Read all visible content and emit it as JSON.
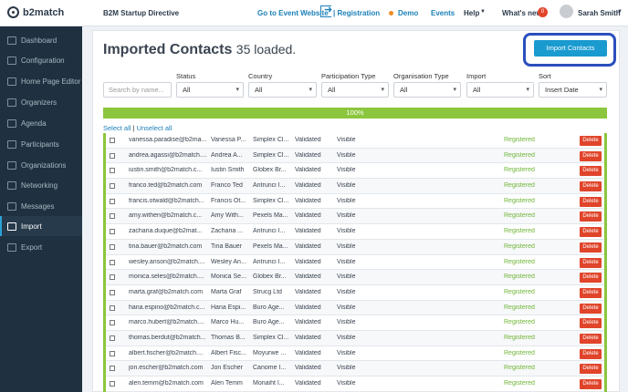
{
  "header": {
    "brand": "b2match",
    "event_name": "B2M Startup Directive",
    "goto_event": "Go to Event Website",
    "registration": "| Registration",
    "demo": "Demo",
    "events": "Events",
    "help": "Help",
    "whats_new": "What's new",
    "notification_count": "0",
    "user_name": "Sarah Smith"
  },
  "sidebar": {
    "items": [
      {
        "label": "Dashboard",
        "icon": "dashboard-icon"
      },
      {
        "label": "Configuration",
        "icon": "wrench-icon"
      },
      {
        "label": "Home Page Editor",
        "icon": "home-icon"
      },
      {
        "label": "Organizers",
        "icon": "people-icon"
      },
      {
        "label": "Agenda",
        "icon": "calendar-icon"
      },
      {
        "label": "Participants",
        "icon": "participant-icon"
      },
      {
        "label": "Organizations",
        "icon": "building-icon"
      },
      {
        "label": "Networking",
        "icon": "network-icon"
      },
      {
        "label": "Messages",
        "icon": "envelope-icon"
      },
      {
        "label": "Import",
        "icon": "import-icon",
        "active": true
      },
      {
        "label": "Export",
        "icon": "export-icon"
      }
    ]
  },
  "page": {
    "title": "Imported Contacts",
    "subtitle": "35 loaded.",
    "import_button": "Import Contacts",
    "search_placeholder": "Search by name...",
    "filters": [
      {
        "label": "Status",
        "value": "All"
      },
      {
        "label": "Country",
        "value": "All"
      },
      {
        "label": "Participation Type",
        "value": "All"
      },
      {
        "label": "Organisation Type",
        "value": "All"
      },
      {
        "label": "Import",
        "value": "All"
      },
      {
        "label": "Sort",
        "value": "Insert Date"
      }
    ],
    "progress_label": "100%",
    "progress_value": 1.0,
    "select_all": "Select all",
    "separator": "|",
    "unselect_all": "Unselect all",
    "delete_label": "Delete"
  },
  "contacts": [
    {
      "email": "vanessa.paradise@b2ma...",
      "name": "Vanessa P...",
      "org": "Simplex Cl...",
      "validated": "Validated",
      "visible": "Visible",
      "status": "Registered"
    },
    {
      "email": "andrea.agassi@b2match....",
      "name": "Andrea A...",
      "org": "Simplex Cl...",
      "validated": "Validated",
      "visible": "Visible",
      "status": "Registered"
    },
    {
      "email": "iustin.smith@b2match.c...",
      "name": "Iustin Smith",
      "org": "Globex Br...",
      "validated": "Validated",
      "visible": "Visible",
      "status": "Registered"
    },
    {
      "email": "franco.ted@b2match.com",
      "name": "Franco Ted",
      "org": "Antrunci I...",
      "validated": "Validated",
      "visible": "Visible",
      "status": "Registered"
    },
    {
      "email": "francis.otwald@b2match...",
      "name": "Francis Ot...",
      "org": "Simplex Cl...",
      "validated": "Validated",
      "visible": "Visible",
      "status": "Registered"
    },
    {
      "email": "amy.withen@b2match.c...",
      "name": "Amy With...",
      "org": "Pexels Ma...",
      "validated": "Validated",
      "visible": "Visible",
      "status": "Registered"
    },
    {
      "email": "zacharia.duque@b2mat...",
      "name": "Zacharia ...",
      "org": "Antrunci I...",
      "validated": "Validated",
      "visible": "Visible",
      "status": "Registered"
    },
    {
      "email": "tina.bauer@b2match.com",
      "name": "Tina Bauer",
      "org": "Pexels Ma...",
      "validated": "Validated",
      "visible": "Visible",
      "status": "Registered"
    },
    {
      "email": "wesley.anson@b2match....",
      "name": "Wesley An...",
      "org": "Antrunci I...",
      "validated": "Validated",
      "visible": "Visible",
      "status": "Registered"
    },
    {
      "email": "monica.seles@b2match....",
      "name": "Monica Se...",
      "org": "Globex Br...",
      "validated": "Validated",
      "visible": "Visible",
      "status": "Registered"
    },
    {
      "email": "marta.graf@b2match.com",
      "name": "Marta Graf",
      "org": "Strucg Ltd",
      "validated": "Validated",
      "visible": "Visible",
      "status": "Registered"
    },
    {
      "email": "hana.espino@b2match.c...",
      "name": "Hana Espi...",
      "org": "Buro Age...",
      "validated": "Validated",
      "visible": "Visible",
      "status": "Registered"
    },
    {
      "email": "marco.hubert@b2match....",
      "name": "Marco Hu...",
      "org": "Buro Age...",
      "validated": "Validated",
      "visible": "Visible",
      "status": "Registered"
    },
    {
      "email": "thomas.berdut@b2match...",
      "name": "Thomas B...",
      "org": "Simplex Cl...",
      "validated": "Validated",
      "visible": "Visible",
      "status": "Registered"
    },
    {
      "email": "albert.fischer@b2match....",
      "name": "Albert Fisc...",
      "org": "Moyurwe ...",
      "validated": "Validated",
      "visible": "Visible",
      "status": "Registered"
    },
    {
      "email": "jon.escher@b2match.com",
      "name": "Jon Escher",
      "org": "Canome I...",
      "validated": "Validated",
      "visible": "Visible",
      "status": "Registered"
    },
    {
      "email": "alen.temm@b2match.com",
      "name": "Alen Temm",
      "org": "Monaiht I...",
      "validated": "Validated",
      "visible": "Visible",
      "status": "Registered"
    }
  ],
  "colors": {
    "sidebar_bg": "#1f3140",
    "accent": "#1a9bd0",
    "progress": "#8cc63f",
    "delete": "#e0452b",
    "registered": "#6fb536"
  }
}
